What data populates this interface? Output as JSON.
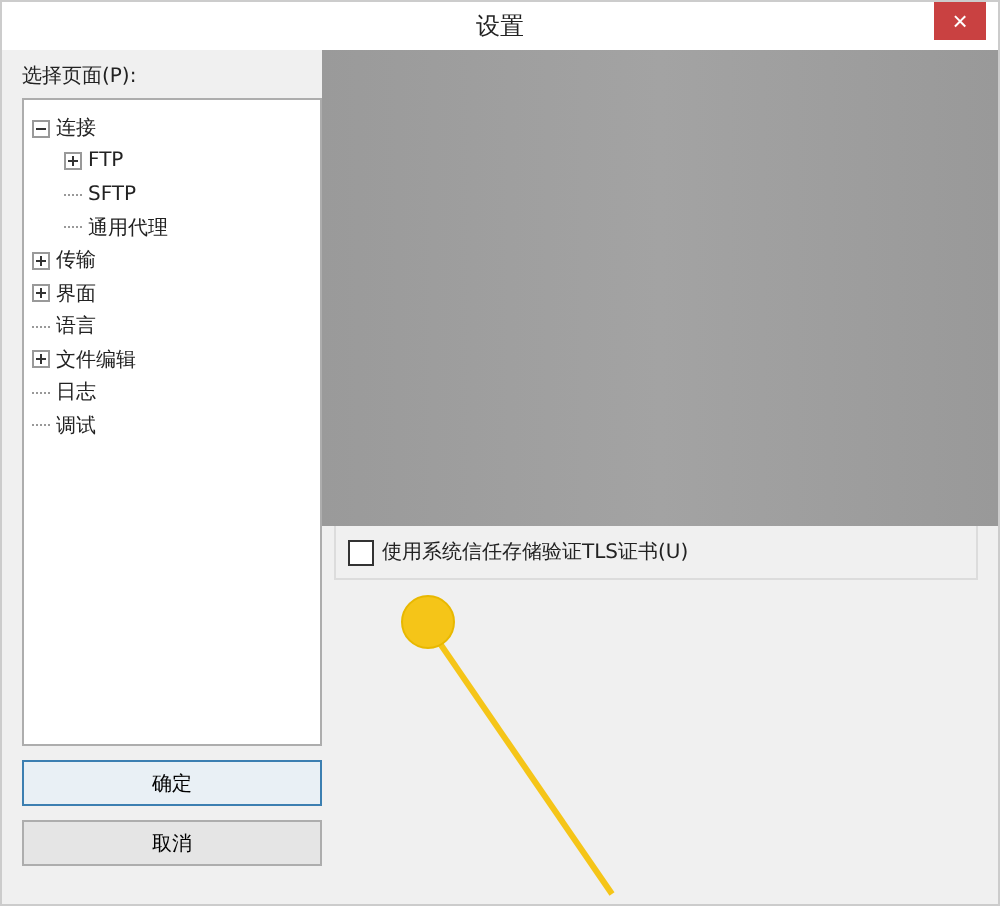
{
  "window": {
    "title": "设置",
    "close": "×"
  },
  "page_selector": {
    "label": "选择页面(P):",
    "tree": [
      {
        "label": "连接",
        "expanded": true,
        "children": [
          {
            "label": "FTP",
            "expanded": false
          },
          {
            "label": "SFTP"
          },
          {
            "label": "通用代理"
          }
        ]
      },
      {
        "label": "传输",
        "expanded": false
      },
      {
        "label": "界面",
        "expanded": false
      },
      {
        "label": "语言"
      },
      {
        "label": "文件编辑",
        "expanded": false
      },
      {
        "label": "日志"
      },
      {
        "label": "调试"
      }
    ]
  },
  "buttons": [
    {
      "label": "确定",
      "selected": true
    },
    {
      "label": "取消",
      "selected": false
    }
  ],
  "options": [
    {
      "label": "使用系统信任存储验证TLS证书(U)",
      "checked": false
    }
  ]
}
